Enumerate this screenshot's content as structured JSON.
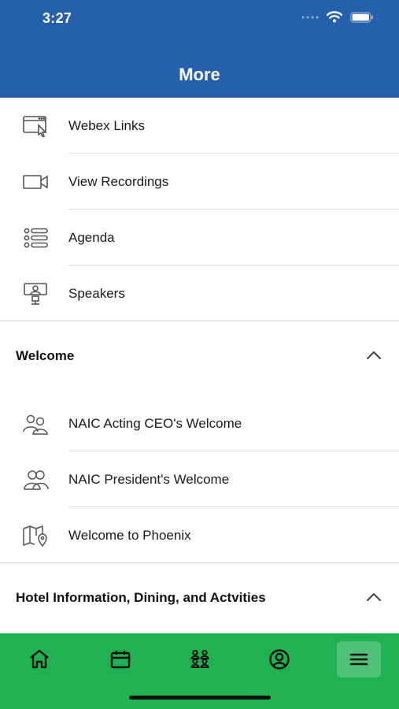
{
  "status": {
    "time": "3:27"
  },
  "header": {
    "title": "More"
  },
  "items_top": [
    {
      "label": "Webex Links",
      "icon": "webex-link-icon"
    },
    {
      "label": "View Recordings",
      "icon": "video-camera-icon"
    },
    {
      "label": "Agenda",
      "icon": "agenda-list-icon"
    },
    {
      "label": "Speakers",
      "icon": "speaker-podium-icon"
    }
  ],
  "sections": [
    {
      "title": "Welcome",
      "expanded": true,
      "items": [
        {
          "label": "NAIC Acting CEO's Welcome",
          "icon": "people-icon"
        },
        {
          "label": "NAIC President's Welcome",
          "icon": "people-icon"
        },
        {
          "label": "Welcome to Phoenix",
          "icon": "map-pin-icon"
        }
      ]
    },
    {
      "title": "Hotel Information, Dining, and Actvities",
      "expanded": true,
      "items": []
    }
  ],
  "tabbar": {
    "items": [
      "home-icon",
      "calendar-icon",
      "attendees-icon",
      "profile-icon",
      "menu-icon"
    ],
    "active": "menu-icon"
  },
  "colors": {
    "header": "#2660ac",
    "tabbar": "#1fb152"
  }
}
